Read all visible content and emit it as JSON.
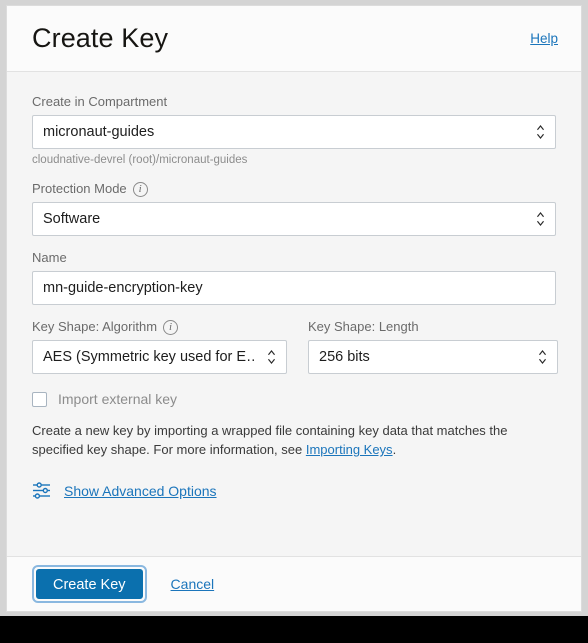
{
  "window": {
    "background_color": "#000000",
    "panel_background": "#f5f5f5"
  },
  "header": {
    "title": "Create Key",
    "help_label": "Help"
  },
  "form": {
    "compartment": {
      "label": "Create in Compartment",
      "value": "micronaut-guides",
      "helper": "cloudnative-devrel (root)/micronaut-guides",
      "stepper_icon": "chevron-up-down-icon"
    },
    "protection_mode": {
      "label": "Protection Mode",
      "info_icon": "info-icon",
      "value": "Software",
      "stepper_icon": "chevron-up-down-icon"
    },
    "name": {
      "label": "Name",
      "value": "mn-guide-encryption-key",
      "placeholder": ""
    },
    "key_shape_algorithm": {
      "label": "Key Shape: Algorithm",
      "info_icon": "info-icon",
      "value": "AES (Symmetric key used for E…",
      "stepper_icon": "chevron-up-down-icon"
    },
    "key_shape_length": {
      "label": "Key Shape: Length",
      "value": "256 bits",
      "stepper_icon": "chevron-up-down-icon"
    },
    "import_external_key": {
      "label": "Import external key",
      "checked": false
    },
    "import_description": {
      "text_before": "Create a new key by importing a wrapped file containing key data that matches the specified key shape. For more information, see ",
      "link_text": "Importing Keys",
      "text_after": "."
    },
    "advanced_options": {
      "icon": "sliders-icon",
      "label": "Show Advanced Options"
    }
  },
  "footer": {
    "primary_label": "Create Key",
    "cancel_label": "Cancel",
    "primary_color": "#0b70ae",
    "focus_ring_color": "#8ab8e0",
    "link_color": "#1b75bb"
  }
}
